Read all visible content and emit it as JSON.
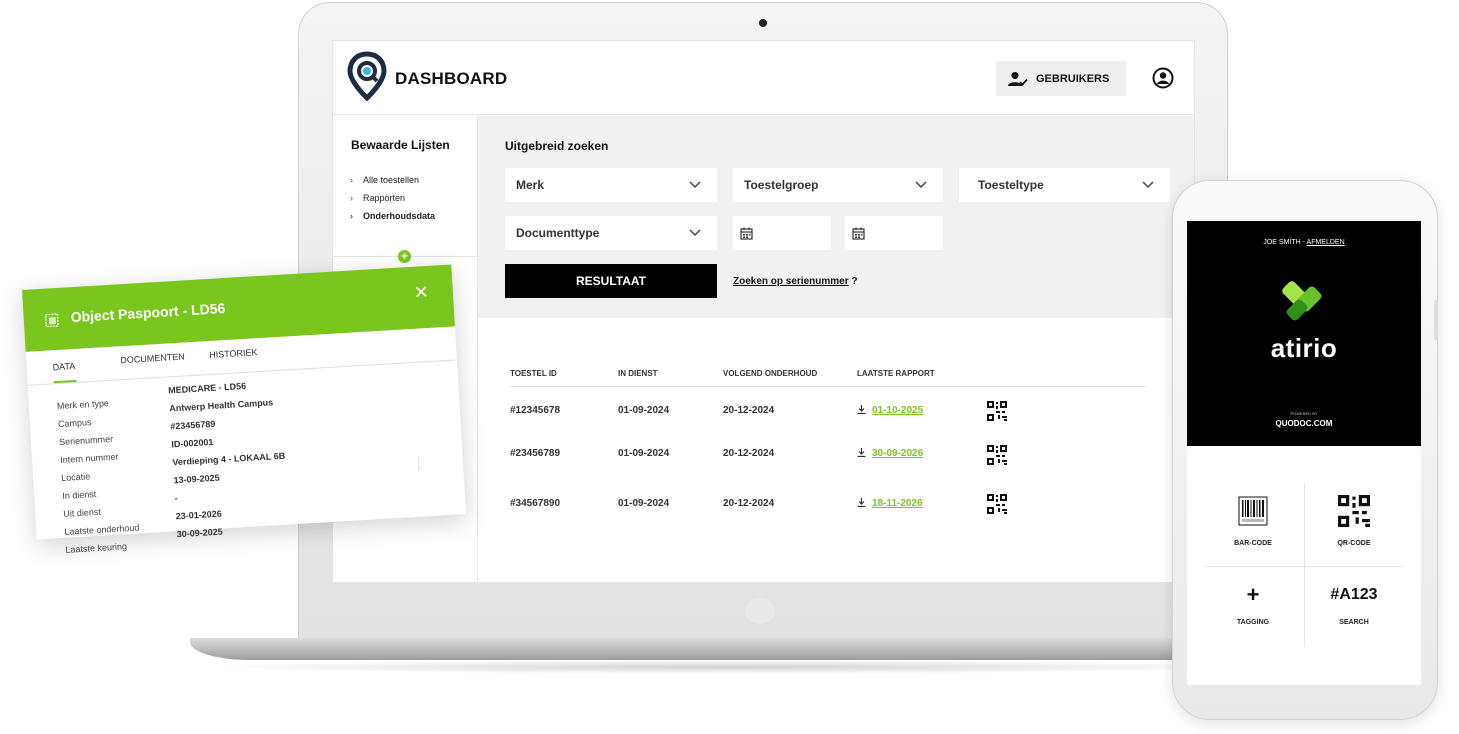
{
  "app": {
    "title": "DASHBOARD",
    "users_button": "GEBRUIKERS"
  },
  "sidebar": {
    "title": "Bewaarde Lijsten",
    "items": [
      {
        "label": "Alle toestellen"
      },
      {
        "label": "Rapporten"
      },
      {
        "label": "Onderhoudsdata"
      }
    ]
  },
  "search": {
    "title": "Uitgebreid zoeken",
    "dropdowns": [
      "Merk",
      "Toestelgroep",
      "Toesteltype",
      "Documenttype"
    ],
    "result_button": "RESULTAAT",
    "serial_link": "Zoeken op serienummer",
    "serial_suffix": " ?"
  },
  "table": {
    "headers": [
      "TOESTEL ID",
      "IN DIENST",
      "VOLGEND ONDERHOUD",
      "LAATSTE RAPPORT"
    ],
    "rows": [
      {
        "id": "#12345678",
        "in_service": "01-09-2024",
        "next_service": "20-12-2024",
        "last_report": "01-10-2025"
      },
      {
        "id": "#23456789",
        "in_service": "01-09-2024",
        "next_service": "20-12-2024",
        "last_report": "30-09-2026"
      },
      {
        "id": "#34567890",
        "in_service": "01-09-2024",
        "next_service": "20-12-2024",
        "last_report": "18-11-2026"
      }
    ]
  },
  "passport": {
    "title": "Object Paspoort - LD56",
    "tabs": [
      "DATA",
      "DOCUMENTEN",
      "HISTORIEK"
    ],
    "fields": [
      {
        "label": "Merk en type",
        "value": "MEDICARE - LD56"
      },
      {
        "label": "Campus",
        "value": "Antwerp Health Campus"
      },
      {
        "label": "Serienummer",
        "value": "#23456789"
      },
      {
        "label": "Intern nummer",
        "value": "ID-002001"
      },
      {
        "label": "Locatie",
        "value": "Verdieping 4 - LOKAAL 6B"
      },
      {
        "label": "In dienst",
        "value": "13-09-2025"
      },
      {
        "label": "Uit dienst",
        "value": "-"
      },
      {
        "label": "Laatste onderhoud",
        "value": "23-01-2026"
      },
      {
        "label": "Laatste keuring",
        "value": "30-09-2025"
      }
    ]
  },
  "phone": {
    "user": "JOE SMITH",
    "separator": " - ",
    "logout": "AFMELDEN",
    "brand": "atirio",
    "powered_by": "POWERED BY",
    "quodoc": "QUODOC.COM",
    "tiles": [
      {
        "label": "BAR-CODE",
        "icon": "barcode-icon"
      },
      {
        "label": "QR-CODE",
        "icon": "qr-code-icon"
      },
      {
        "label": "TAGGING",
        "icon": "plus-icon"
      },
      {
        "label": "SEARCH",
        "code": "#A123"
      }
    ]
  },
  "colors": {
    "accent": "#7ac51e",
    "panel": "#f1f1f1",
    "dark": "#000000"
  }
}
